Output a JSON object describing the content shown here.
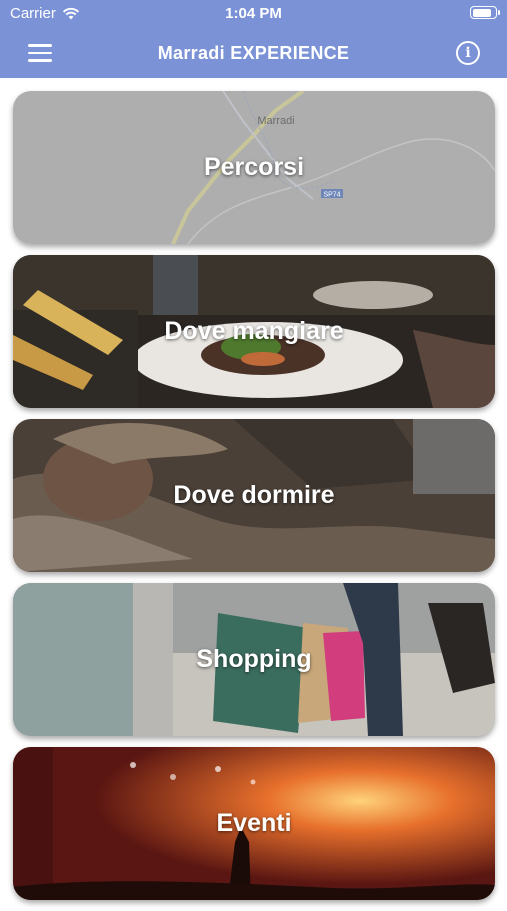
{
  "status_bar": {
    "carrier": "Carrier",
    "time": "1:04 PM",
    "battery_level": 0.9,
    "wifi_icon": "wifi-icon"
  },
  "nav_bar": {
    "title": "Marradi EXPERIENCE",
    "menu_icon": "hamburger-menu-icon",
    "info_icon": "info-icon",
    "color": "#7b93d6"
  },
  "cards": [
    {
      "label": "Percorsi",
      "map_label": "Marradi",
      "road_label": "SP74"
    },
    {
      "label": "Dove mangiare"
    },
    {
      "label": "Dove dormire"
    },
    {
      "label": "Shopping"
    },
    {
      "label": "Eventi"
    }
  ]
}
